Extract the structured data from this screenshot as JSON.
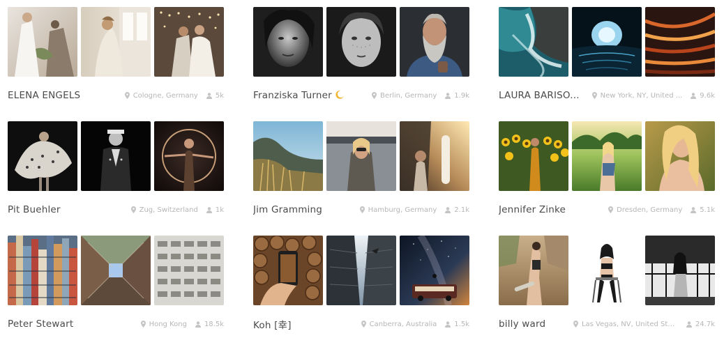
{
  "colors": {
    "name_text": "#4a4a4a",
    "meta_text": "#b6b6b6"
  },
  "icons": {
    "location": "map-pin-icon",
    "followers": "user-icon",
    "emoji": "crescent-moon-icon"
  },
  "photographers": [
    {
      "name": "ELENA ENGELS",
      "location": "Cologne, Germany",
      "followers": "5k",
      "photos": [
        "wedding bride in white dress with bouquet",
        "bride by window with lace veil",
        "couple kissing under string lights"
      ]
    },
    {
      "name": "Franziska Turner",
      "emoji": "🌙",
      "location": "Berlin, Germany",
      "followers": "1.9k",
      "photos": [
        "black and white portrait of woman",
        "black and white freckled woman portrait",
        "bearded man in denim jacket"
      ]
    },
    {
      "name": "LAURA BARISO...",
      "location": "New York, NY, United ...",
      "followers": "9.6k",
      "photos": [
        "aerial ocean waves on rocks",
        "sea cave with blue light",
        "orange light trails long exposure"
      ]
    },
    {
      "name": "Pit Buehler",
      "location": "Zug, Switzerland",
      "followers": "1k",
      "photos": [
        "dancer in swirling fabric",
        "man in suit and cap black and white",
        "woman with hoop in dark studio"
      ]
    },
    {
      "name": "Jim Gramming",
      "location": "Hamburg, Germany",
      "followers": "2.1k",
      "photos": [
        "mountain cliffs with golden grass",
        "woman under car hatch",
        "surfboard and van at sunset"
      ]
    },
    {
      "name": "Jennifer Zinke",
      "location": "Dresden, Germany",
      "followers": "5.1k",
      "photos": [
        "woman in sunflower field",
        "woman in green meadow",
        "blonde woman in golden light"
      ]
    },
    {
      "name": "Peter Stewart",
      "location": "Hong Kong",
      "followers": "18.5k",
      "photos": [
        "dense colorful city buildings",
        "looking up between buildings",
        "facade of repeating windows"
      ]
    },
    {
      "name": "Koh [幸]",
      "location": "Canberra, Australia",
      "followers": "1.5k",
      "photos": [
        "phone held over firewood",
        "under a bridge looking up",
        "van under starry night sky"
      ]
    },
    {
      "name": "billy ward",
      "location": "Las Vegas, NV, United States",
      "followers": "24.7k",
      "photos": [
        "woman with skateboard on street",
        "woman in heels on chair",
        "black and white woman by railing"
      ]
    }
  ]
}
